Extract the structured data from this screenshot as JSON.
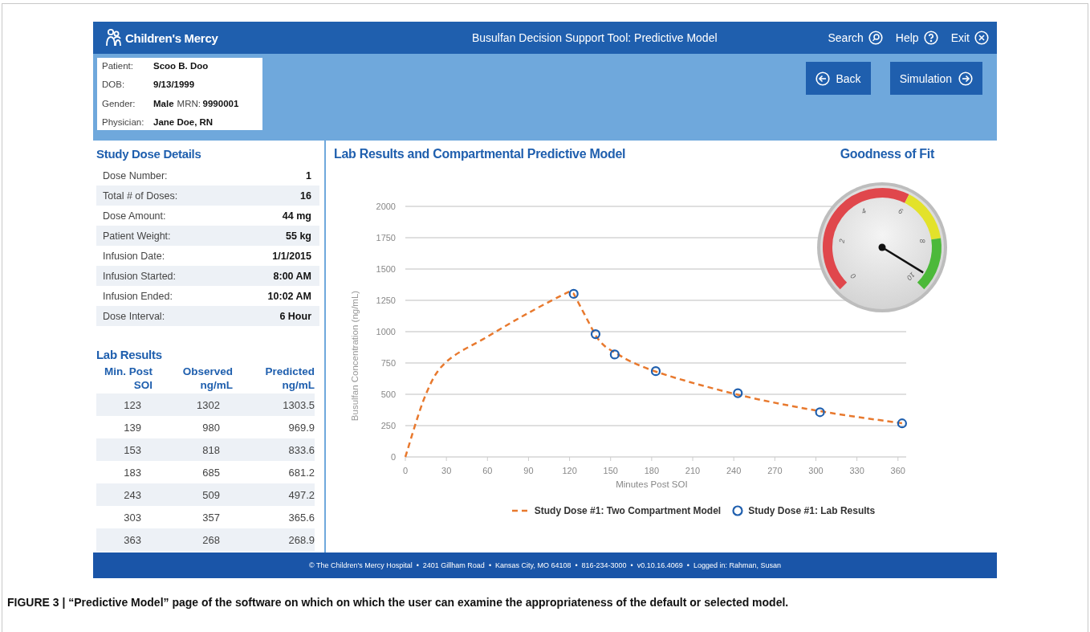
{
  "header": {
    "logo": "Children's Mercy",
    "title": "Busulfan Decision Support Tool: Predictive Model",
    "links": [
      {
        "kind": "search",
        "label": "Search"
      },
      {
        "kind": "help",
        "label": "Help"
      },
      {
        "kind": "exit",
        "label": "Exit"
      }
    ]
  },
  "patient": {
    "lines": [
      [
        {
          "label": "Patient:",
          "value": "Scoo B. Doo"
        }
      ],
      [
        {
          "label": "DOB:",
          "value": "9/13/1999"
        }
      ],
      [
        {
          "label": "Gender:",
          "value": "Male"
        },
        {
          "label": "MRN:",
          "value": "9990001"
        }
      ],
      [
        {
          "label": "Physician:",
          "value": "Jane Doe, RN"
        }
      ]
    ]
  },
  "nav_buttons": [
    {
      "kind": "back",
      "label": "Back"
    },
    {
      "kind": "next",
      "label": "Simulation"
    }
  ],
  "study_dose": {
    "title": "Study Dose Details",
    "rows": [
      {
        "label": "Dose Number:",
        "value": "1"
      },
      {
        "label": "Total # of Doses:",
        "value": "16"
      },
      {
        "label": "Dose Amount:",
        "value": "44 mg"
      },
      {
        "label": "Patient Weight:",
        "value": "55 kg"
      },
      {
        "label": "Infusion Date:",
        "value": "1/1/2015"
      },
      {
        "label": "Infusion Started:",
        "value": "8:00 AM"
      },
      {
        "label": "Infusion Ended:",
        "value": "10:02 AM"
      },
      {
        "label": "Dose Interval:",
        "value": "6 Hour"
      }
    ]
  },
  "lab_results": {
    "title": "Lab Results",
    "columns": [
      "Min. Post SOI",
      "Observed ng/mL",
      "Predicted ng/mL"
    ],
    "rows": [
      [
        "123",
        "1302",
        "1303.5"
      ],
      [
        "139",
        "980",
        "969.9"
      ],
      [
        "153",
        "818",
        "833.6"
      ],
      [
        "183",
        "685",
        "681.2"
      ],
      [
        "243",
        "509",
        "497.2"
      ],
      [
        "303",
        "357",
        "365.6"
      ],
      [
        "363",
        "268",
        "268.9"
      ]
    ]
  },
  "model_panel": {
    "title": "Lab Results and Compartmental Predictive Model",
    "chart_data": {
      "type": "line",
      "xlabel": "Minutes Post SOI",
      "ylabel": "Busulfan Concentration (ng/mL)",
      "x": [
        0,
        15,
        30,
        60,
        90,
        120,
        123,
        139,
        153,
        183,
        243,
        303,
        363
      ],
      "series": [
        {
          "name": "Study Dose #1: Two Compartment Model",
          "color": "#e8792e",
          "line_style": "dashed",
          "values": [
            0,
            500,
            760,
            960,
            1150,
            1320,
            1303.5,
            969.9,
            833.6,
            681.2,
            497.2,
            365.6,
            268.9
          ]
        },
        {
          "name": "Study Dose #1: Lab Results",
          "color": "#1f5fae",
          "type": "scatter",
          "values": [
            null,
            null,
            null,
            null,
            null,
            null,
            1302,
            980,
            818,
            685,
            509,
            357,
            268
          ]
        }
      ],
      "xlim": [
        0,
        366
      ],
      "ylim": [
        0,
        2000
      ],
      "grid": true,
      "xticks": [
        0,
        30,
        60,
        90,
        120,
        150,
        180,
        210,
        240,
        270,
        300,
        330,
        360
      ],
      "yticks": [
        0,
        250,
        500,
        750,
        1000,
        1250,
        1500,
        1750,
        2000
      ]
    }
  },
  "gauge": {
    "title": "Goodness of Fit",
    "ticks": [
      "0",
      "2",
      "4",
      "6",
      "8",
      "10"
    ]
  },
  "footer": "© The Children's Mercy Hospital  •  2401 Gillham Road  •  Kansas City, MO 64108  •  816-234-3000  •  v0.10.16.4069  •  Logged in: Rahman, Susan",
  "caption": "FIGURE 3 | “Predictive Model” page of the software on which on which the user can examine the appropriateness of the default or selected model."
}
